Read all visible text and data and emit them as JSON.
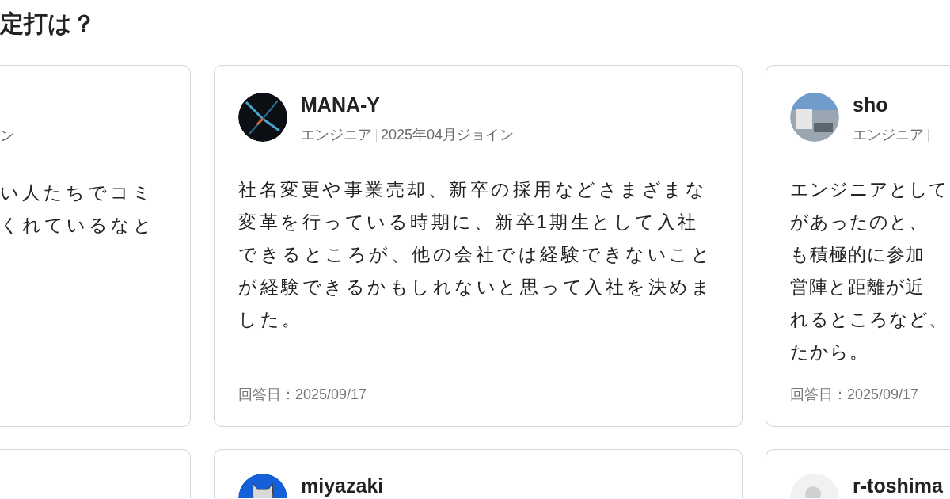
{
  "heading": "定打は？",
  "rows": [
    [
      {
        "joined": "ン",
        "answer_lines": [
          "い人たちでコミ",
          "くれているなと"
        ]
      },
      {
        "avatar": {
          "kind": "art"
        },
        "name": "MANA-Y",
        "role": "エンジニア",
        "joined": "2025年04月ジョイン",
        "answer": "社名変更や事業売却、新卒の採用などさまざまな変革を行っている時期に、新卒1期生として入社できるところが、他の会社では経験できないことが経験できるかもしれないと思って入社を決めました。",
        "answered": "回答日：2025/09/17"
      },
      {
        "avatar": {
          "kind": "photo"
        },
        "name": "sho",
        "role": "エンジニア",
        "answer_lines": [
          "エンジニアとして",
          "があったのと、",
          "も積極的に参加",
          "営陣と距離が近",
          "れるところなど、",
          "たから。"
        ],
        "answered": "回答日：2025/09/17"
      }
    ],
    [
      {},
      {
        "avatar": {
          "kind": "illustration"
        },
        "name": "miyazaki"
      },
      {
        "avatar": {
          "kind": "default"
        },
        "name": "r-toshima"
      }
    ]
  ]
}
